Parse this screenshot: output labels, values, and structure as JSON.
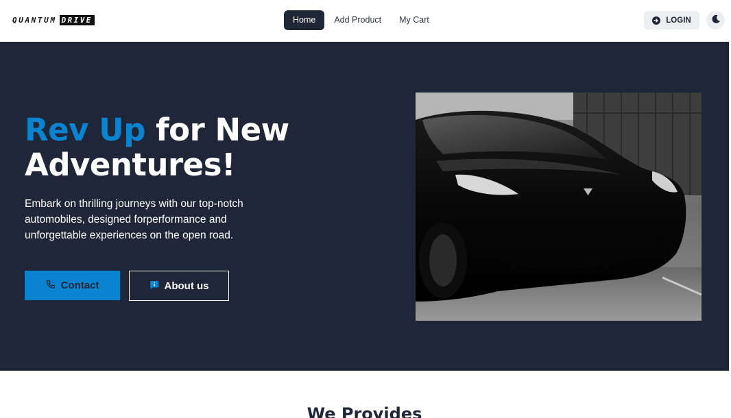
{
  "brand": {
    "part1": "QUANTUM",
    "part2": "DRIVE"
  },
  "nav": {
    "links": [
      {
        "label": "Home",
        "active": true
      },
      {
        "label": "Add Product",
        "active": false
      },
      {
        "label": "My Cart",
        "active": false
      }
    ],
    "login_label": "LOGIN",
    "login_icon": "login-arrow-icon",
    "theme_icon": "moon-icon"
  },
  "hero": {
    "title_accent": "Rev Up",
    "title_rest_line1": " for New",
    "title_line2": "Adventures!",
    "description": "Embark on thrilling journeys with our top-notch automobiles, designed forperformance and unforgettable experiences on the open road.",
    "contact_label": "Contact",
    "contact_icon": "phone-icon",
    "about_label": "About us",
    "about_icon": "info-chat-icon",
    "image_alt": "black-electric-car-photo"
  },
  "next_section": {
    "title": "We Provides"
  },
  "colors": {
    "accent": "#0a84d0",
    "hero_bg": "#1f2637",
    "nav_active_bg": "#1f2736"
  }
}
